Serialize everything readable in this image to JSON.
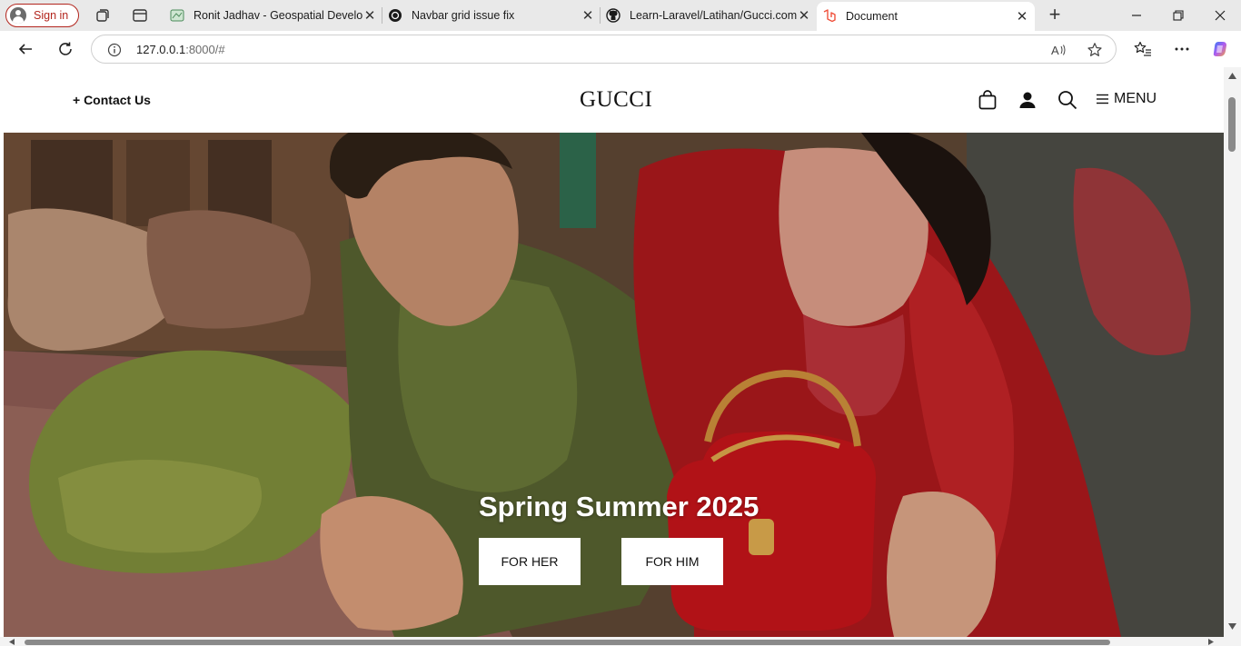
{
  "browser": {
    "sign_in_label": "Sign in",
    "tabs": [
      {
        "title": "Ronit Jadhav - Geospatial Develop",
        "icon": "map-favicon",
        "active": false
      },
      {
        "title": "Navbar grid issue fix",
        "icon": "chatgpt-favicon",
        "active": false
      },
      {
        "title": "Learn-Laravel/Latihan/Gucci.com",
        "icon": "github-favicon",
        "active": false
      },
      {
        "title": "Document",
        "icon": "laravel-favicon",
        "active": true
      }
    ],
    "new_tab_label": "+",
    "address": {
      "host": "127.0.0.1",
      "rest": ":8000/#"
    },
    "colors": {
      "tabstrip": "#e9e9e9",
      "signin_accent": "#b3261e"
    }
  },
  "site": {
    "contact_label": "+ Contact Us",
    "logo": "GUCCI",
    "menu_label": "MENU",
    "hero": {
      "title": "Spring Summer 2025",
      "buttons": [
        {
          "label": "FOR HER"
        },
        {
          "label": "FOR HIM"
        }
      ]
    },
    "icons": [
      "shopping-bag-icon",
      "user-icon",
      "search-icon",
      "menu-icon"
    ]
  }
}
